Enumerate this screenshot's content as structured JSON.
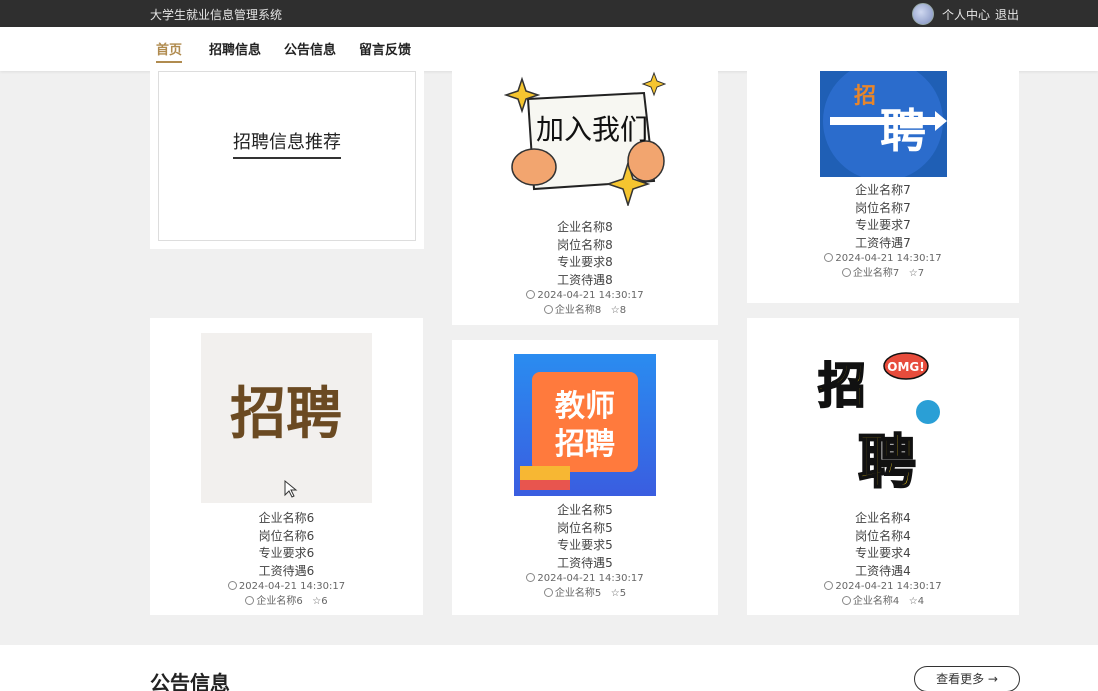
{
  "topbar": {
    "title": "大学生就业信息管理系统",
    "user_center": "个人中心",
    "logout": "退出"
  },
  "nav": {
    "items": [
      "首页",
      "招聘信息",
      "公告信息",
      "留言反馈"
    ]
  },
  "recommend": {
    "title": "招聘信息推荐"
  },
  "cards": [
    {
      "name": "企业名称8",
      "position": "岗位名称8",
      "major": "专业要求8",
      "salary": "工资待遇8",
      "time": "2024-04-21 14:30:17",
      "company": "企业名称8",
      "likes": "8",
      "image_text": "加入我们"
    },
    {
      "name": "企业名称7",
      "position": "岗位名称7",
      "major": "专业要求7",
      "salary": "工资待遇7",
      "time": "2024-04-21 14:30:17",
      "company": "企业名称7",
      "likes": "7",
      "image_text": "招聘"
    },
    {
      "name": "企业名称6",
      "position": "岗位名称6",
      "major": "专业要求6",
      "salary": "工资待遇6",
      "time": "2024-04-21 14:30:17",
      "company": "企业名称6",
      "likes": "6",
      "image_text": "招聘"
    },
    {
      "name": "企业名称5",
      "position": "岗位名称5",
      "major": "专业要求5",
      "salary": "工资待遇5",
      "time": "2024-04-21 14:30:17",
      "company": "企业名称5",
      "likes": "5",
      "image_text": "教师招聘"
    },
    {
      "name": "企业名称4",
      "position": "岗位名称4",
      "major": "专业要求4",
      "salary": "工资待遇4",
      "time": "2024-04-21 14:30:17",
      "company": "企业名称4",
      "likes": "4",
      "image_text": "招聘"
    }
  ],
  "notice": {
    "title": "公告信息",
    "more": "查看更多 →"
  }
}
